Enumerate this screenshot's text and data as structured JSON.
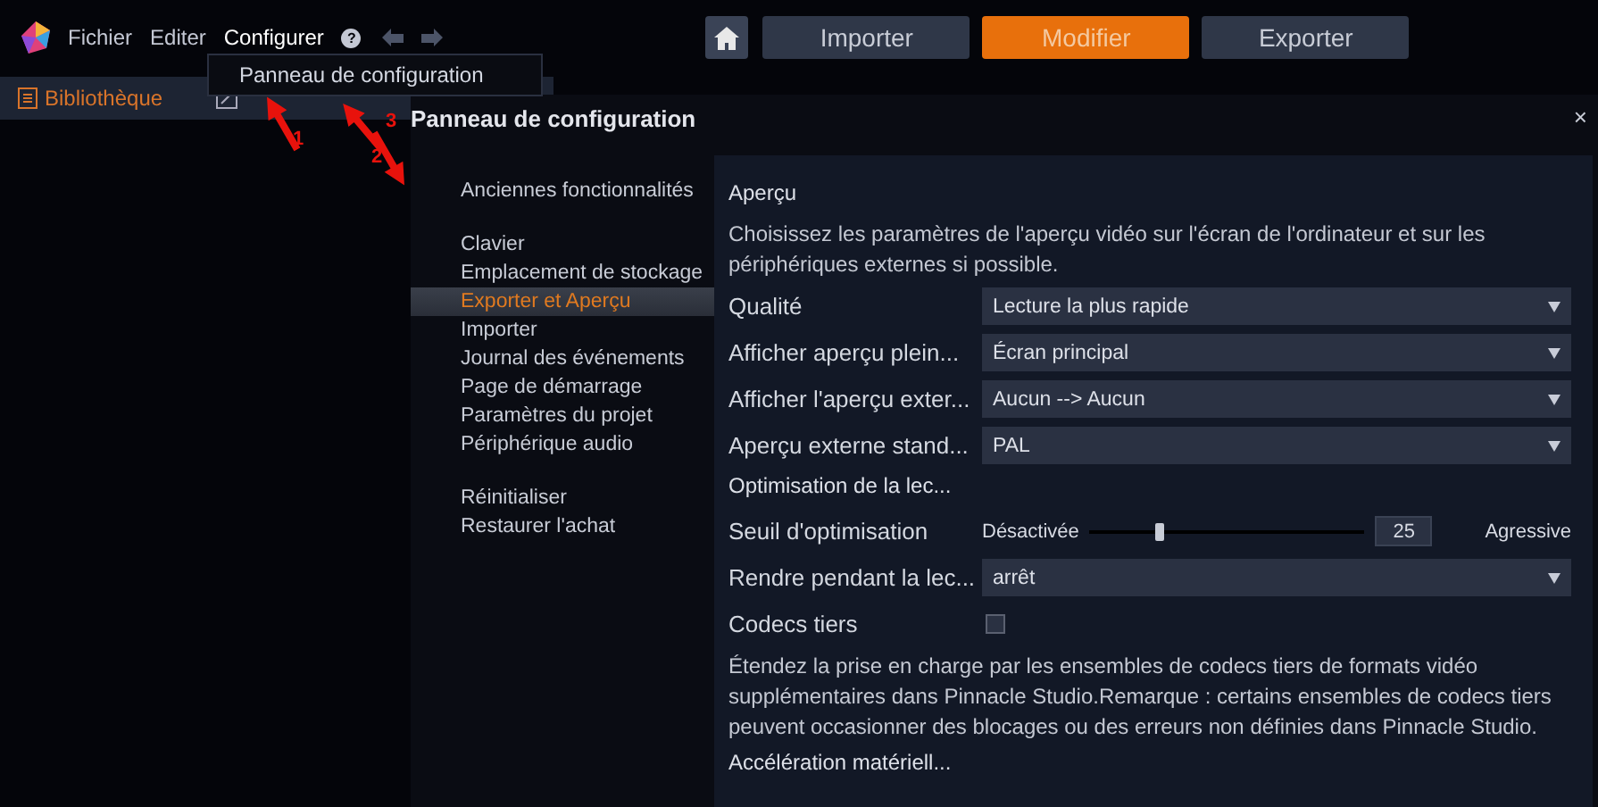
{
  "menu_bar": {
    "items": [
      "Fichier",
      "Editer",
      "Configurer"
    ],
    "help": "?"
  },
  "mode_tabs": [
    {
      "label": "Importer",
      "selected": false
    },
    {
      "label": "Modifier",
      "selected": true
    },
    {
      "label": "Exporter",
      "selected": false
    }
  ],
  "sub_tabs": [
    {
      "label": "Bibliothèque",
      "selected": true
    }
  ],
  "dropdown_menu": {
    "items": [
      "Panneau de configuration"
    ]
  },
  "annotations": [
    {
      "label": "1"
    },
    {
      "label": "2"
    },
    {
      "label": "3"
    }
  ],
  "dialog": {
    "title": "Panneau de configuration",
    "close": "×",
    "nav_groups": [
      {
        "items": [
          {
            "label": "Anciennes fonctionnalités",
            "selected": false
          }
        ]
      },
      {
        "items": [
          {
            "label": "Clavier",
            "selected": false
          },
          {
            "label": "Emplacement de stockage",
            "selected": false
          },
          {
            "label": "Exporter et Aperçu",
            "selected": true
          },
          {
            "label": "Importer",
            "selected": false
          },
          {
            "label": "Journal des événements",
            "selected": false
          },
          {
            "label": "Page de démarrage",
            "selected": false
          },
          {
            "label": "Paramètres du projet",
            "selected": false
          },
          {
            "label": "Périphérique audio",
            "selected": false
          }
        ]
      },
      {
        "items": [
          {
            "label": "Réinitialiser",
            "selected": false
          },
          {
            "label": "Restaurer l'achat",
            "selected": false
          }
        ]
      }
    ],
    "settings": [
      {
        "kind": "heading",
        "label": "Aperçu"
      },
      {
        "kind": "text",
        "text": "Choisissez les paramètres de l'aperçu vidéo sur l'écran de l'ordinateur et sur les périphériques externes si possible."
      },
      {
        "kind": "select",
        "label": "Qualité",
        "value": "Lecture la plus rapide"
      },
      {
        "kind": "select",
        "label": "Afficher aperçu plein...",
        "value": "Écran principal"
      },
      {
        "kind": "select",
        "label": "Afficher l'aperçu exter...",
        "value": "Aucun --> Aucun"
      },
      {
        "kind": "select",
        "label": "Aperçu externe stand...",
        "value": "PAL"
      },
      {
        "kind": "heading",
        "label": "Optimisation de la lec..."
      },
      {
        "kind": "slider",
        "label": "Seuil d'optimisation",
        "min_label": "Désactivée",
        "max_label": "Agressive",
        "level": 0.25,
        "value": "25"
      },
      {
        "kind": "select",
        "label": "Rendre pendant la lec...",
        "value": "arrêt"
      },
      {
        "kind": "checkbox",
        "label": "Codecs tiers",
        "checked": false
      },
      {
        "kind": "text",
        "text": "Étendez la prise en charge par les ensembles de codecs tiers de formats vidéo supplémentaires dans Pinnacle Studio.Remarque : certains ensembles de codecs tiers peuvent occasionner des blocages ou des erreurs non définies dans Pinnacle Studio."
      },
      {
        "kind": "heading",
        "label": "Accélération matériell..."
      }
    ]
  }
}
